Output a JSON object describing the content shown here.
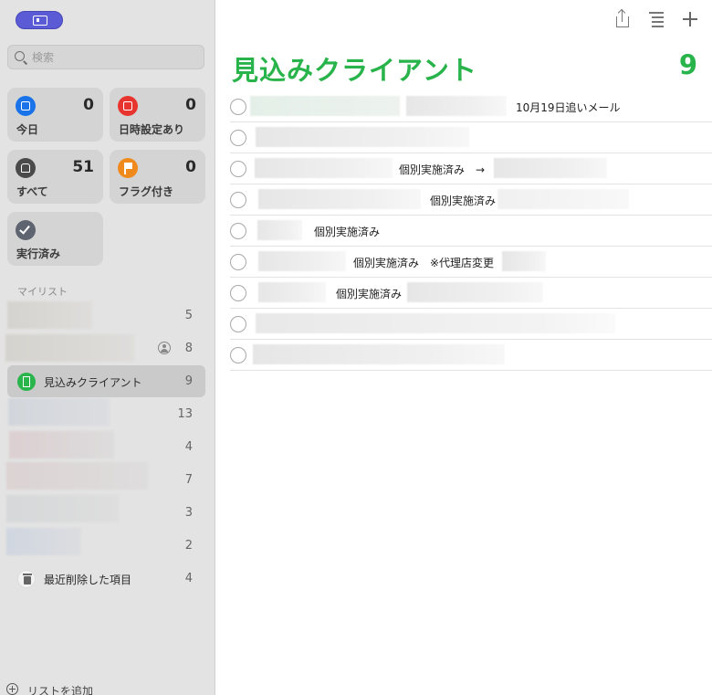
{
  "search": {
    "placeholder": "検索"
  },
  "smart_lists": [
    {
      "id": "today",
      "label": "今日",
      "count": "0",
      "icon": "calendar-icon",
      "color": "#1a73e8"
    },
    {
      "id": "scheduled",
      "label": "日時設定あり",
      "count": "0",
      "icon": "calendar-grid-icon",
      "color": "#e8342e"
    },
    {
      "id": "all",
      "label": "すべて",
      "count": "51",
      "icon": "tray-icon",
      "color": "#4a4a4a"
    },
    {
      "id": "flagged",
      "label": "フラグ付き",
      "count": "0",
      "icon": "flag-icon",
      "color": "#f08a1c"
    },
    {
      "id": "completed",
      "label": "実行済み",
      "icon": "checkmark-icon",
      "color": "#5e6570"
    }
  ],
  "my_lists": {
    "label": "マイリスト",
    "items": [
      {
        "name": "",
        "count": "5",
        "redacted": true
      },
      {
        "name": "",
        "count": "8",
        "redacted": true,
        "shared": true
      },
      {
        "name": "見込みクライアント",
        "count": "9",
        "selected": true,
        "icon": "building-icon",
        "color": "#2ab54c"
      },
      {
        "name": "",
        "count": "13",
        "redacted": true
      },
      {
        "name": "",
        "count": "4",
        "redacted": true
      },
      {
        "name": "",
        "count": "7",
        "redacted": true
      },
      {
        "name": "",
        "count": "3",
        "redacted": true
      },
      {
        "name": "",
        "count": "2",
        "redacted": true
      },
      {
        "name": "最近削除した項目",
        "count": "4",
        "icon": "trash-icon"
      }
    ]
  },
  "add_list_label": "リストを追加",
  "main": {
    "title": "見込みクライアント",
    "total": "9",
    "accent_color": "#28b44a",
    "tasks": [
      {
        "visible_text": "10月19日追いメール"
      },
      {
        "visible_text": ""
      },
      {
        "visible_text": "個別実施済み　→"
      },
      {
        "visible_text": "個別実施済み"
      },
      {
        "visible_text": "個別実施済み"
      },
      {
        "visible_text": "個別実施済み　※代理店変更"
      },
      {
        "visible_text": "個別実施済み"
      },
      {
        "visible_text": ""
      },
      {
        "visible_text": ""
      }
    ]
  }
}
